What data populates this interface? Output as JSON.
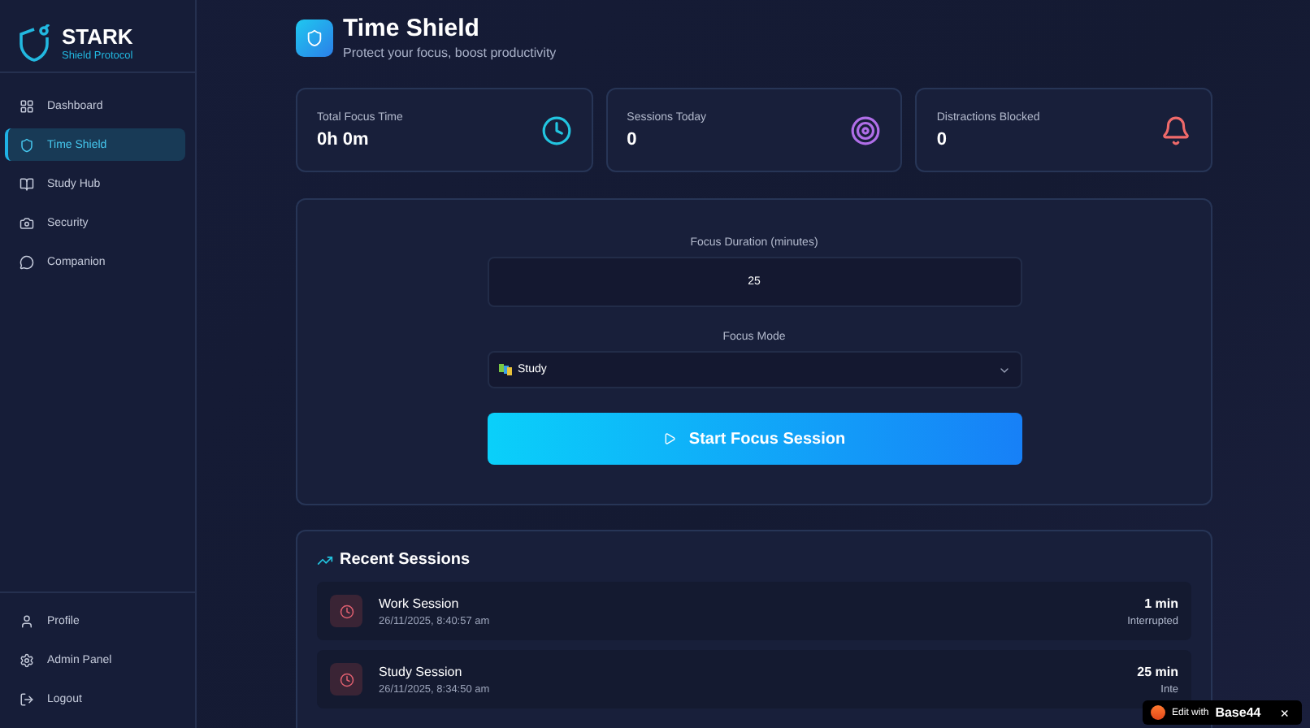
{
  "brand": {
    "name": "STARK",
    "tagline": "Shield Protocol"
  },
  "nav": [
    {
      "label": "Dashboard",
      "selected": false
    },
    {
      "label": "Time Shield",
      "selected": true
    },
    {
      "label": "Study Hub",
      "selected": false
    },
    {
      "label": "Security",
      "selected": false
    },
    {
      "label": "Companion",
      "selected": false
    }
  ],
  "nav_bottom": [
    {
      "label": "Profile"
    },
    {
      "label": "Admin Panel"
    },
    {
      "label": "Logout"
    }
  ],
  "header": {
    "title": "Time Shield",
    "subtitle": "Protect your focus, boost productivity"
  },
  "stats": [
    {
      "label": "Total Focus Time",
      "value": "0h 0m",
      "color": "#22c5e0"
    },
    {
      "label": "Sessions Today",
      "value": "0",
      "color": "#b06ee8"
    },
    {
      "label": "Distractions Blocked",
      "value": "0",
      "color": "#ef6a6a"
    }
  ],
  "form": {
    "duration_label": "Focus Duration (minutes)",
    "duration_value": "25",
    "mode_label": "Focus Mode",
    "mode_value": "Study",
    "start_button": "Start Focus Session"
  },
  "recent": {
    "title": "Recent Sessions",
    "sessions": [
      {
        "name": "Work Session",
        "time": "26/11/2025, 8:40:57 am",
        "duration": "1 min",
        "status": "Interrupted"
      },
      {
        "name": "Study Session",
        "time": "26/11/2025, 8:34:50 am",
        "duration": "25 min",
        "status": "Inte"
      }
    ]
  },
  "badge": {
    "prefix": "Edit with",
    "brand": "Base44",
    "close": "×"
  }
}
